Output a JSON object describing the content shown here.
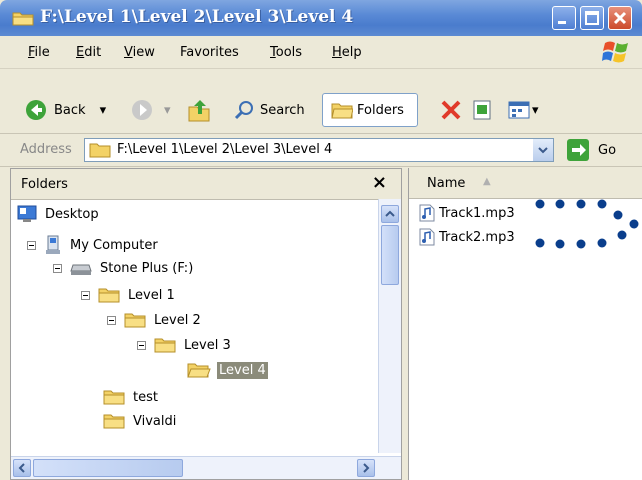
{
  "window": {
    "title": "F:\\Level 1\\Level 2\\Level 3\\Level 4"
  },
  "menu": [
    {
      "first": "F",
      "rest": "ile"
    },
    {
      "first": "E",
      "rest": "dit"
    },
    {
      "first": "V",
      "rest": "iew"
    },
    {
      "first": "",
      "rest": "Favorites"
    },
    {
      "first": "T",
      "rest": "ools"
    },
    {
      "first": "H",
      "rest": "elp"
    }
  ],
  "toolbar": {
    "back_label": "Back",
    "search_label": "Search",
    "folders_label": "Folders"
  },
  "address": {
    "label": "Address",
    "value": "F:\\Level 1\\Level 2\\Level 3\\Level 4",
    "go_label": "Go"
  },
  "folders_pane": {
    "header": "Folders",
    "close": "×",
    "tree": [
      {
        "label": "Desktop",
        "icon": "desktop-icon"
      },
      {
        "label": "My Computer",
        "icon": "computer-icon"
      },
      {
        "label": "Stone Plus (F:)",
        "icon": "drive-icon"
      },
      {
        "label": "Level 1",
        "icon": "folder-icon"
      },
      {
        "label": "Level 2",
        "icon": "folder-icon"
      },
      {
        "label": "Level 3",
        "icon": "folder-icon"
      },
      {
        "label": "Level 4",
        "icon": "folder-open-icon",
        "selected": true
      },
      {
        "label": "test",
        "icon": "folder-icon"
      },
      {
        "label": "Vivaldi",
        "icon": "folder-icon"
      }
    ]
  },
  "file_pane": {
    "column_name": "Name",
    "files": [
      {
        "name": "Track1.mp3",
        "icon": "audio-file-icon"
      },
      {
        "name": "Track2.mp3",
        "icon": "audio-file-icon"
      }
    ]
  },
  "colors": {
    "title_bar": "#5a8ad6",
    "selection": "#8b8b7a",
    "annotation_dots": "#0a3e8c"
  }
}
